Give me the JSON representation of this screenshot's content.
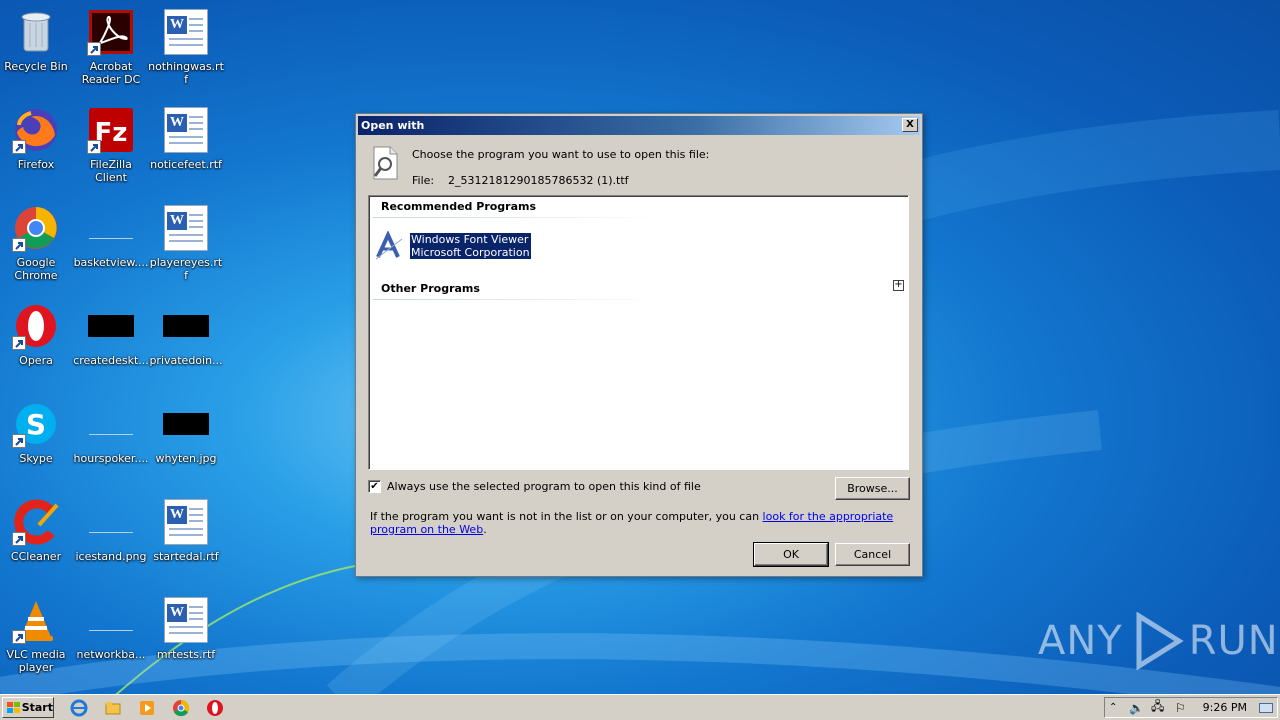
{
  "desktop": {
    "icons": [
      {
        "label": "Recycle Bin",
        "icon": "recycle-bin-icon"
      },
      {
        "label": "Acrobat Reader DC",
        "icon": "acrobat-icon"
      },
      {
        "label": "nothingwas.rtf",
        "icon": "word-doc-icon"
      },
      {
        "label": "Firefox",
        "icon": "firefox-icon"
      },
      {
        "label": "FileZilla Client",
        "icon": "filezilla-icon"
      },
      {
        "label": "noticefeet.rtf",
        "icon": "word-doc-icon"
      },
      {
        "label": "Google Chrome",
        "icon": "chrome-icon"
      },
      {
        "label": "basketview....",
        "icon": "blank-file-icon"
      },
      {
        "label": "playereyes.rtf",
        "icon": "word-doc-icon"
      },
      {
        "label": "Opera",
        "icon": "opera-icon"
      },
      {
        "label": "createdeskt...",
        "icon": "black-image-icon"
      },
      {
        "label": "privatedoin...",
        "icon": "black-image-icon"
      },
      {
        "label": "Skype",
        "icon": "skype-icon"
      },
      {
        "label": "hourspoker....",
        "icon": "blank-file-icon"
      },
      {
        "label": "whyten.jpg",
        "icon": "black-image-icon"
      },
      {
        "label": "CCleaner",
        "icon": "ccleaner-icon"
      },
      {
        "label": "icestand.png",
        "icon": "blank-file-icon"
      },
      {
        "label": "startedal.rtf",
        "icon": "word-doc-icon"
      },
      {
        "label": "VLC media player",
        "icon": "vlc-icon"
      },
      {
        "label": "networkba...",
        "icon": "blank-file-icon"
      },
      {
        "label": "mrtests.rtf",
        "icon": "word-doc-icon"
      }
    ]
  },
  "dialog": {
    "title": "Open with",
    "close_label": "X",
    "prompt": "Choose the program you want to use to open this file:",
    "file_label": "File:",
    "file_name": "2_5312181290185786532 (1).ttf",
    "recommended_header": "Recommended Programs",
    "recommended": [
      {
        "name": "Windows Font Viewer",
        "company": "Microsoft Corporation",
        "icon": "font-viewer-icon"
      }
    ],
    "other_header": "Other Programs",
    "expand_label": "+",
    "always_use_label": "Always use the selected program to open this kind of file",
    "always_use_checked": true,
    "check_mark": "✔",
    "browse_label": "Browse...",
    "help_text": "If the program you want is not in the list or on your computer, you can ",
    "help_link": "look for the appropriate program on the Web",
    "help_end": ".",
    "ok_label": "OK",
    "cancel_label": "Cancel"
  },
  "watermark": {
    "left": "ANY",
    "right": "RUN"
  },
  "taskbar": {
    "start_label": "Start",
    "pinned": [
      "internet-explorer-icon",
      "file-explorer-icon",
      "media-player-icon",
      "chrome-icon",
      "opera-icon"
    ],
    "clock": "9:26 PM"
  }
}
